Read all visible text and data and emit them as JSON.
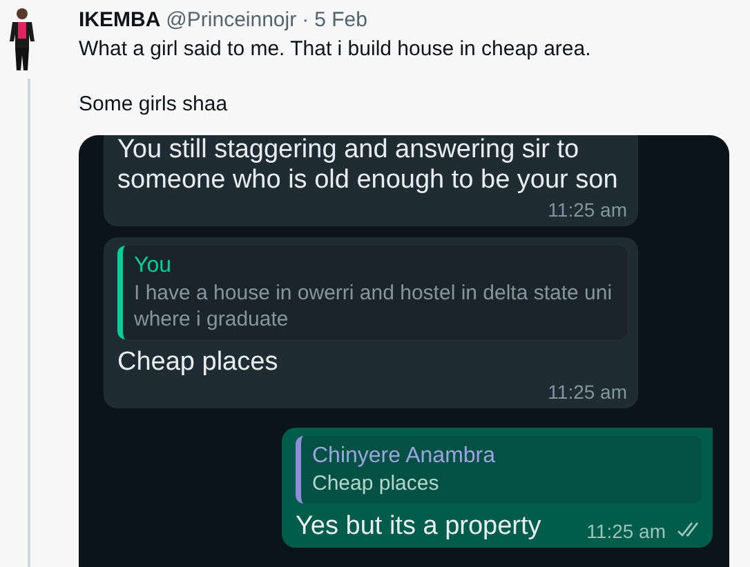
{
  "tweet": {
    "author": "IKEMBA",
    "handle": "@Princeinnojr",
    "separator": "·",
    "date": "5 Feb",
    "text": "What a girl said to me. That i build house in cheap area.",
    "text_2": "Some girls shaa"
  },
  "messages": [
    {
      "kind": "received",
      "text": "You still staggering and answering sir to someone who is old enough to be your son",
      "time": "11:25 am"
    },
    {
      "kind": "received",
      "quote": {
        "author": "You",
        "text": "I have a house in owerri and hostel in delta state uni where i graduate"
      },
      "text": "Cheap places",
      "time": "11:25 am"
    },
    {
      "kind": "sent",
      "quote": {
        "author": "Chinyere Anambra",
        "text": "Cheap places"
      },
      "text": "Yes but its a property",
      "time": "11:25 am"
    }
  ]
}
